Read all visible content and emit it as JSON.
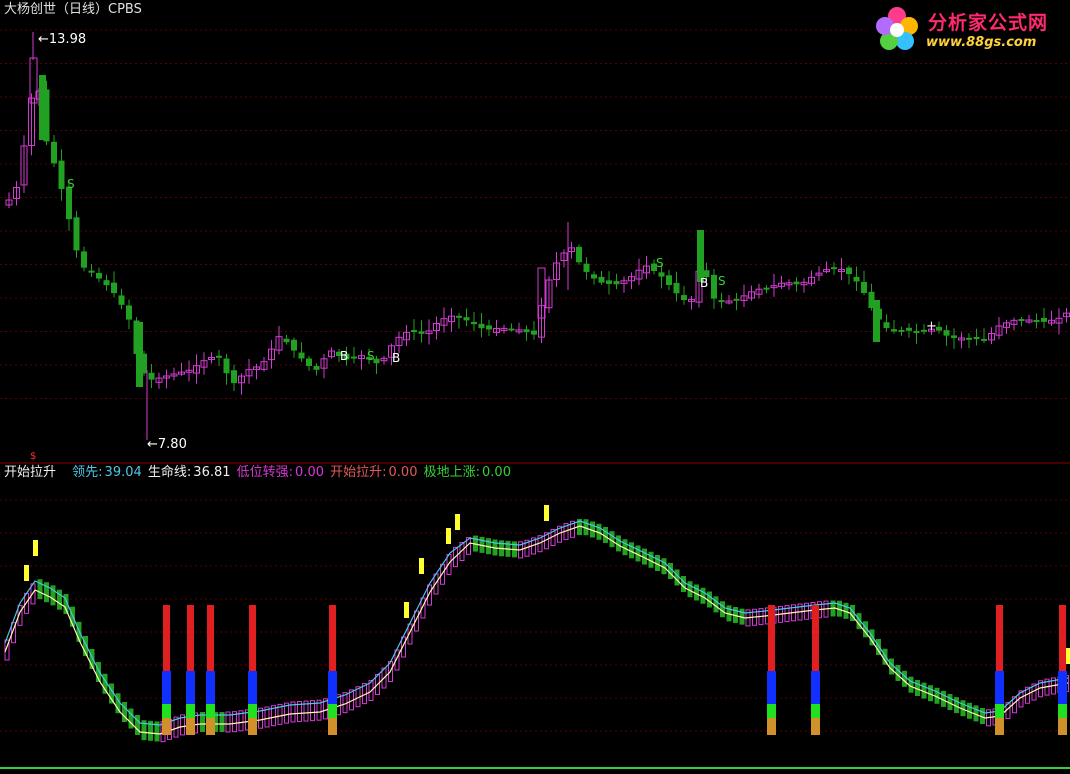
{
  "header": {
    "title": "大杨创世（日线）CPBS"
  },
  "price_panel": {
    "high_label": "13.98",
    "low_label": "7.80",
    "signals": [
      "S",
      "B",
      "S",
      "B",
      "S",
      "B",
      "S"
    ],
    "colors": {
      "up": "#d43bd4",
      "down": "#22a022",
      "grid": "#5a0000",
      "text": "#ffffff"
    }
  },
  "indicator_bar": {
    "name": "开始拉升",
    "items": [
      {
        "label": "领先:",
        "value": "39.04",
        "color": "#4ec7e6"
      },
      {
        "label": "生命线:",
        "value": "36.81",
        "color": "#f0f0f0"
      },
      {
        "label": "低位转强:",
        "value": "0.00",
        "color": "#d43bd4"
      },
      {
        "label": "开始拉升:",
        "value": "0.00",
        "color": "#e05a5a"
      },
      {
        "label": "极地上涨:",
        "value": "0.00",
        "color": "#35d035"
      }
    ]
  },
  "logo": {
    "name": "分析家公式网",
    "url": "www.88gs.com"
  }
}
